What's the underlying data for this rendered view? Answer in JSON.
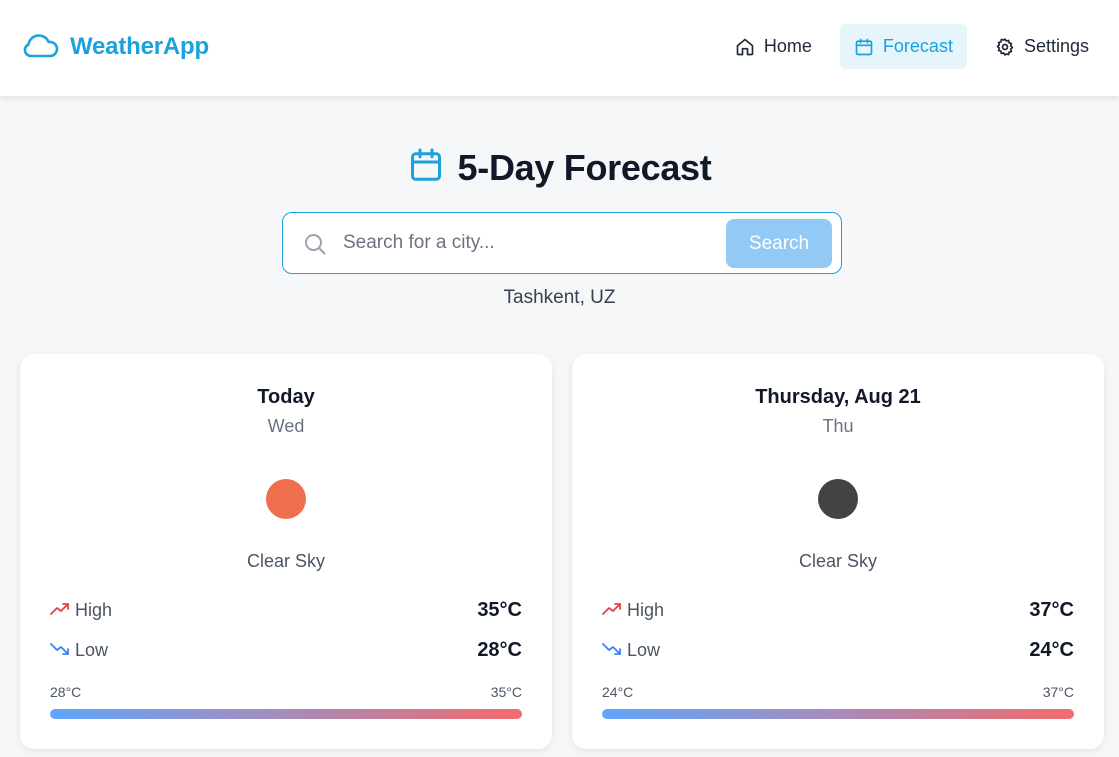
{
  "brand": {
    "name": "WeatherApp",
    "icon": "cloud-icon",
    "color": "#1ba1dc"
  },
  "nav": {
    "items": [
      {
        "label": "Home",
        "icon": "home-icon",
        "active": false
      },
      {
        "label": "Forecast",
        "icon": "calendar-icon",
        "active": true
      },
      {
        "label": "Settings",
        "icon": "gear-icon",
        "active": false
      }
    ]
  },
  "page": {
    "title": "5-Day Forecast",
    "title_icon": "calendar-icon"
  },
  "search": {
    "placeholder": "Search for a city...",
    "value": "",
    "button_label": "Search"
  },
  "location": "Tashkent, UZ",
  "forecast": [
    {
      "date": "Today",
      "day": "Wed",
      "condition": "Clear Sky",
      "dot_color": "#ee6e4e",
      "high_label": "High",
      "high": "35°C",
      "low_label": "Low",
      "low": "28°C",
      "range_min": "28°C",
      "range_max": "35°C"
    },
    {
      "date": "Thursday, Aug 21",
      "day": "Thu",
      "condition": "Clear Sky",
      "dot_color": "#434343",
      "high_label": "High",
      "high": "37°C",
      "low_label": "Low",
      "low": "24°C",
      "range_min": "24°C",
      "range_max": "37°C"
    }
  ]
}
